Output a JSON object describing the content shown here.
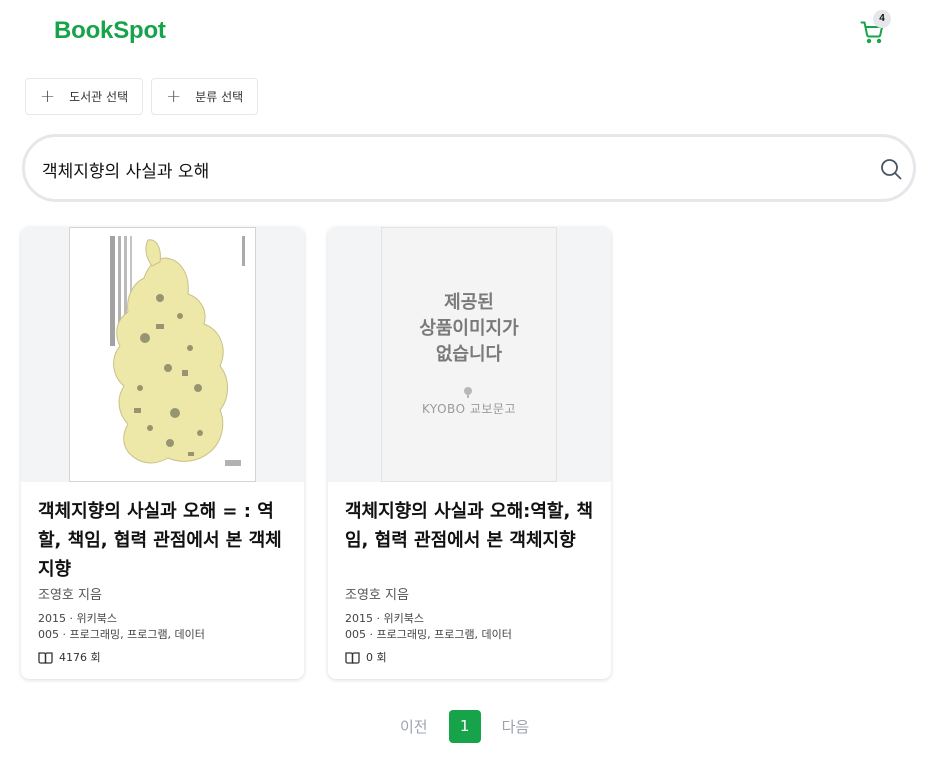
{
  "header": {
    "logo": "BookSpot",
    "cart_count": "4"
  },
  "filters": [
    {
      "label": "도서관 선택"
    },
    {
      "label": "분류 선택"
    }
  ],
  "search": {
    "value": "객체지향의 사실과 오해"
  },
  "books": [
    {
      "title": "객체지향의 사실과 오해 = : 역할, 책임, 협력 관점에서 본 객체지향",
      "author": "조영호 지음",
      "year_publisher": "2015 · 위키북스",
      "classification": "005 · 프로그래밍, 프로그램, 데이터",
      "loans": "4176 회"
    },
    {
      "title": "객체지향의 사실과 오해:역할, 책임, 협력 관점에서 본 객체지향",
      "author": "조영호 지음",
      "year_publisher": "2015 · 위키북스",
      "classification": "005 · 프로그래밍, 프로그램, 데이터",
      "loans": "0 회",
      "cover_placeholder": {
        "lines": [
          "제공된",
          "상품이미지가",
          "없습니다"
        ],
        "brand": "KYOBO 교보문고"
      }
    }
  ],
  "pagination": {
    "prev": "이전",
    "current": "1",
    "next": "다음"
  },
  "colors": {
    "accent": "#16a34a"
  }
}
